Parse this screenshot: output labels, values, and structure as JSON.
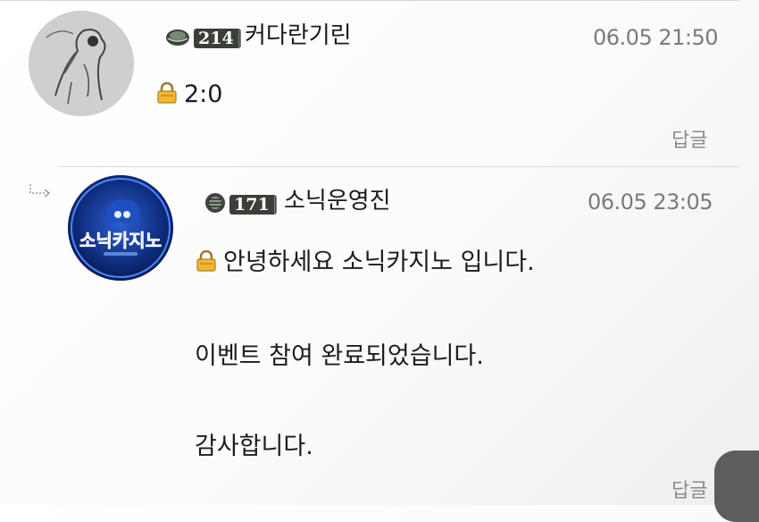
{
  "comments": [
    {
      "level": "214",
      "nickname": "커다란기린",
      "timestamp": "06.05 21:50",
      "lines": [
        "2:0"
      ],
      "reply_label": "답글"
    },
    {
      "level": "171",
      "nickname": "소닉운영진",
      "timestamp": "06.05 23:05",
      "lines": [
        "안녕하세요 소닉카지노 입니다.",
        "이벤트 참여 완료되었습니다.",
        "감사합니다."
      ],
      "reply_label": "답글",
      "avatar_text": "소닉카지노"
    }
  ]
}
